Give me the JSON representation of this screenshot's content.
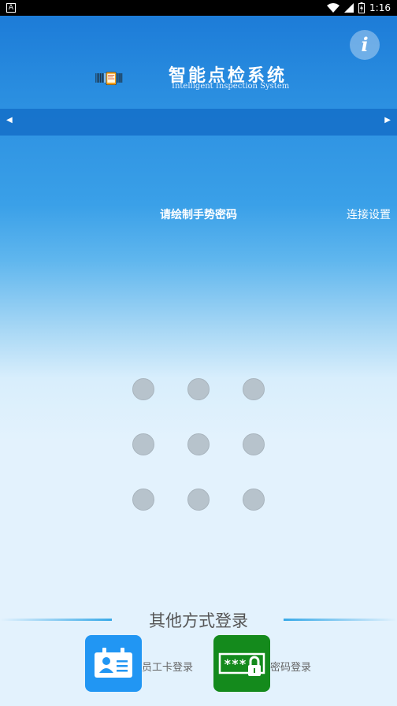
{
  "status_bar": {
    "time": "1:16",
    "icons": [
      "notification-a-icon",
      "wifi-icon",
      "signal-icon",
      "battery-charging-icon"
    ]
  },
  "header": {
    "title": "智能点检系统",
    "subtitle": "Intelligent Inspection System",
    "info_label": "i"
  },
  "nav": {
    "prev_icon": "◀",
    "next_icon": "▶"
  },
  "gesture": {
    "prompt": "请绘制手势密码",
    "settings_label": "连接设置",
    "dot_count": 9
  },
  "other_login": {
    "title": "其他方式登录",
    "options": [
      {
        "label": "员工卡登录",
        "icon": "employee-card-icon",
        "color": "#2196f3"
      },
      {
        "label": "密码登录",
        "icon": "password-lock-icon",
        "color": "#148a1c"
      }
    ]
  },
  "colors": {
    "accent_blue": "#2196f3",
    "accent_green": "#148a1c",
    "dot_gray": "#b7c3cc"
  }
}
